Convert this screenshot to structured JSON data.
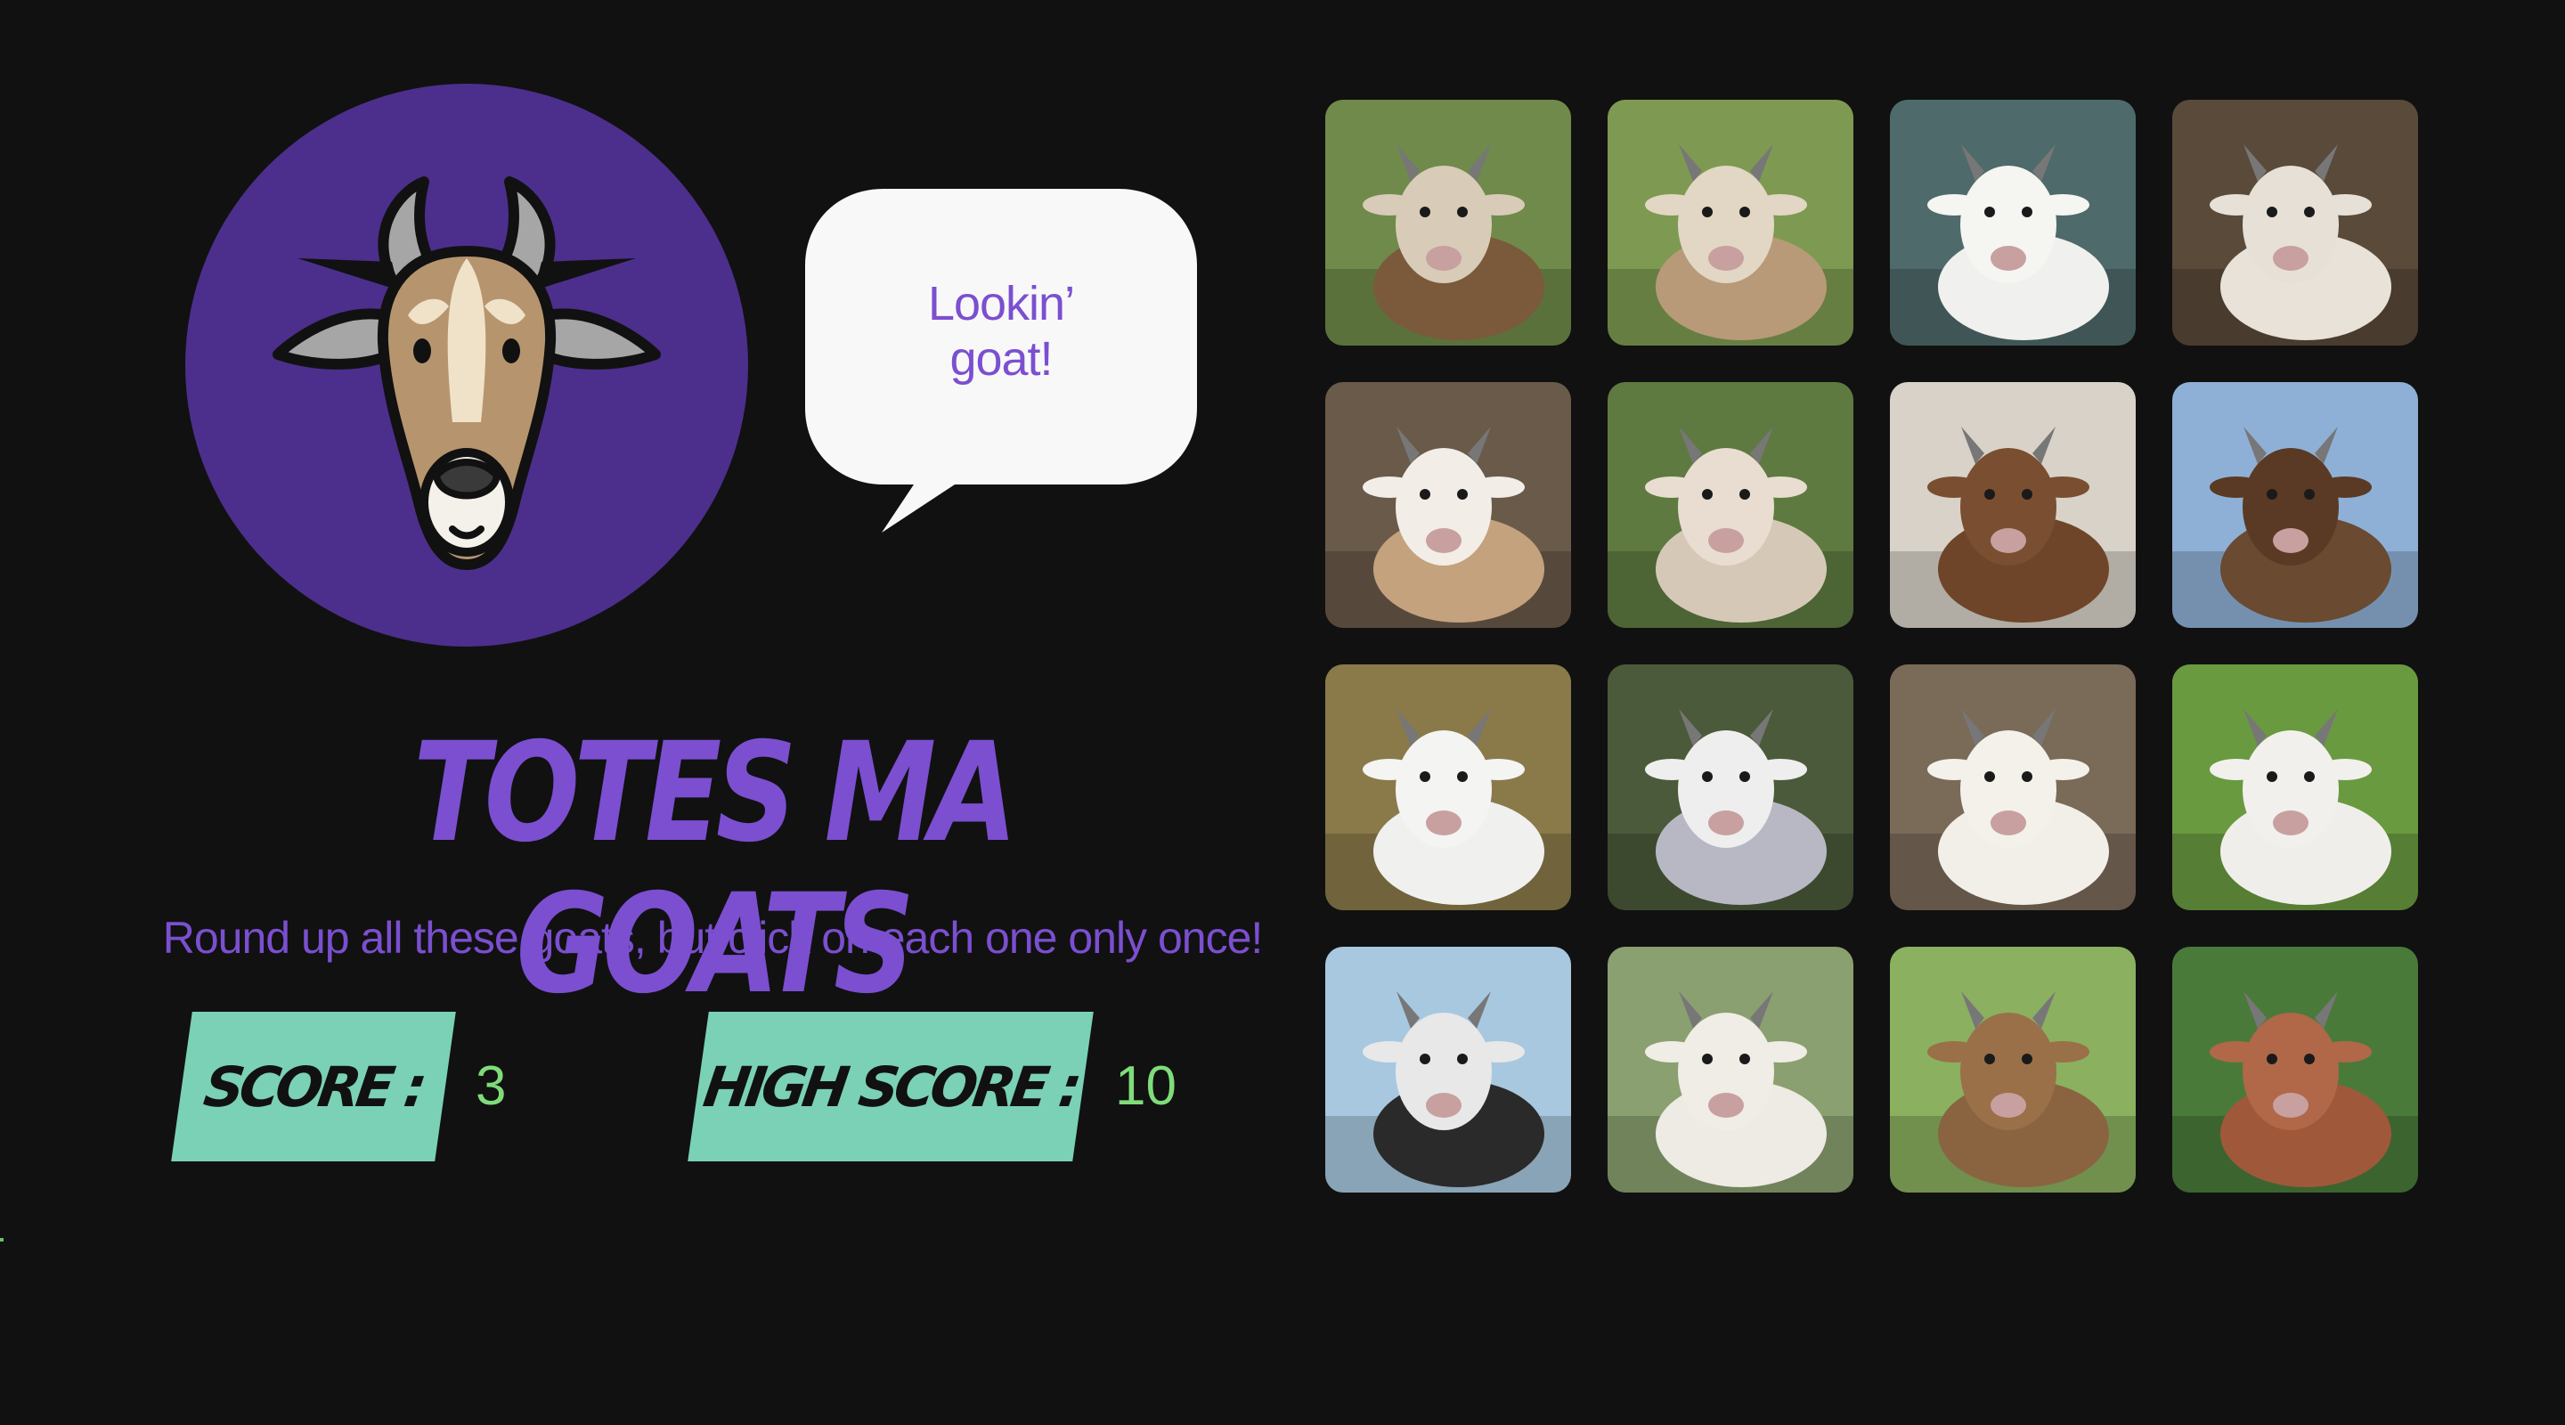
{
  "bubble": {
    "line1": "Lookin’",
    "line2": "goat!"
  },
  "title": "TOTES MA GOATS",
  "subtitle": "Round up all these goats, but click on each one only once!",
  "score": {
    "label": "SCORE :",
    "value": "3"
  },
  "high_score": {
    "label": "HIGH SCORE :",
    "value": "10"
  },
  "colors": {
    "background": "#111111",
    "accent_purple": "#7b4fd0",
    "avatar_purple": "#4c2f8c",
    "badge_teal": "#7ad1b6",
    "score_green": "#7fdc7a"
  },
  "avatar_icon": "goat-face-icon",
  "cards": [
    {
      "name": "goat-card-1",
      "bg": "#6f8a4a",
      "body": "#7a5a3a",
      "head": "#d8cbb8"
    },
    {
      "name": "goat-card-2",
      "bg": "#7e9a52",
      "body": "#b89a78",
      "head": "#e2d6c4"
    },
    {
      "name": "goat-card-3",
      "bg": "#4f6a6a",
      "body": "#f0f0ee",
      "head": "#f5f5f2"
    },
    {
      "name": "goat-card-4",
      "bg": "#5a4a3a",
      "body": "#e8e2d8",
      "head": "#e6e0d6"
    },
    {
      "name": "goat-card-5",
      "bg": "#6a5a4a",
      "body": "#c4a27e",
      "head": "#f2ede6"
    },
    {
      "name": "goat-card-6",
      "bg": "#5e7a40",
      "body": "#d6c8b6",
      "head": "#e8ddd0"
    },
    {
      "name": "goat-card-7",
      "bg": "#d8d2c8",
      "body": "#6e4528",
      "head": "#7a4e30"
    },
    {
      "name": "goat-card-8",
      "bg": "#8fb0d6",
      "body": "#6a4a30",
      "head": "#5a3a24"
    },
    {
      "name": "goat-card-9",
      "bg": "#8a7a4a",
      "body": "#f0f0ee",
      "head": "#f4f4f2"
    },
    {
      "name": "goat-card-10",
      "bg": "#4a5a3a",
      "body": "#b8b8c4",
      "head": "#eeeeee"
    },
    {
      "name": "goat-card-11",
      "bg": "#7a6a58",
      "body": "#f2eee8",
      "head": "#f4f0ea"
    },
    {
      "name": "goat-card-12",
      "bg": "#6a9a40",
      "body": "#f0eeea",
      "head": "#f2f0ec"
    },
    {
      "name": "goat-card-13",
      "bg": "#a8c8e0",
      "body": "#2a2a2a",
      "head": "#e8e8e8"
    },
    {
      "name": "goat-card-14",
      "bg": "#8aa070",
      "body": "#eeeae4",
      "head": "#f0ece6"
    },
    {
      "name": "goat-card-15",
      "bg": "#8ab060",
      "body": "#8a6440",
      "head": "#9a7048"
    },
    {
      "name": "goat-card-16",
      "bg": "#4a7a3a",
      "body": "#a0583a",
      "head": "#b06848"
    }
  ]
}
